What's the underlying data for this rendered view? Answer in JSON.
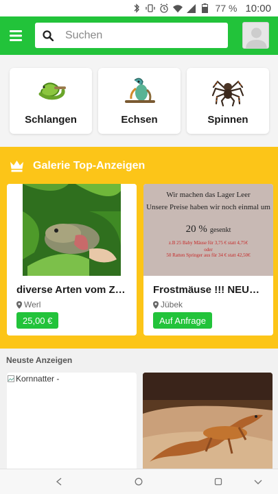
{
  "status_bar": {
    "battery": "77 %",
    "time": "10:00",
    "icons": [
      "bluetooth-icon",
      "vibrate-icon",
      "alarm-icon",
      "wifi-icon",
      "signal-icon",
      "battery-icon"
    ]
  },
  "header": {
    "menu_icon": "hamburger-menu-icon",
    "search_placeholder": "Suchen",
    "search_icon": "search-icon",
    "avatar_icon": "user-avatar-icon",
    "colors": {
      "header_bg": "#22c33a"
    }
  },
  "categories": [
    {
      "label": "Schlangen",
      "icon": "snake-icon"
    },
    {
      "label": "Echsen",
      "icon": "lizard-icon"
    },
    {
      "label": "Spinnen",
      "icon": "spider-icon"
    }
  ],
  "gallery": {
    "title": "Galerie Top-Anzeigen",
    "icon": "crown-icon",
    "color": "#fcc518",
    "items": [
      {
        "title": "diverse Arten vom Zü...",
        "location": "Werl",
        "price": "25,00 €"
      },
      {
        "title": "Frostmäuse !!! NEUE P...",
        "location": "Jübek",
        "price": "Auf Anfrage",
        "image_text": {
          "line1": "Wir machen das Lager Leer",
          "line2": "Unsere Preise haben wir noch einmal um",
          "line3": "20 %",
          "line3_suffix": "gesenkt",
          "line4": "z.B 25 Baby Mäuse für 3,75 € statt 4,75€",
          "line5": "oder",
          "line6": "50 Ratten Springer aus für 34 € statt 42,50€"
        }
      }
    ]
  },
  "newest": {
    "title": "Neuste Anzeigen",
    "items": [
      {
        "alt": "Kornnatter -"
      },
      {
        "alt": ""
      }
    ]
  },
  "nav_bar": {
    "icons": [
      "back-icon",
      "home-icon",
      "recents-icon",
      "dropdown-icon"
    ]
  }
}
